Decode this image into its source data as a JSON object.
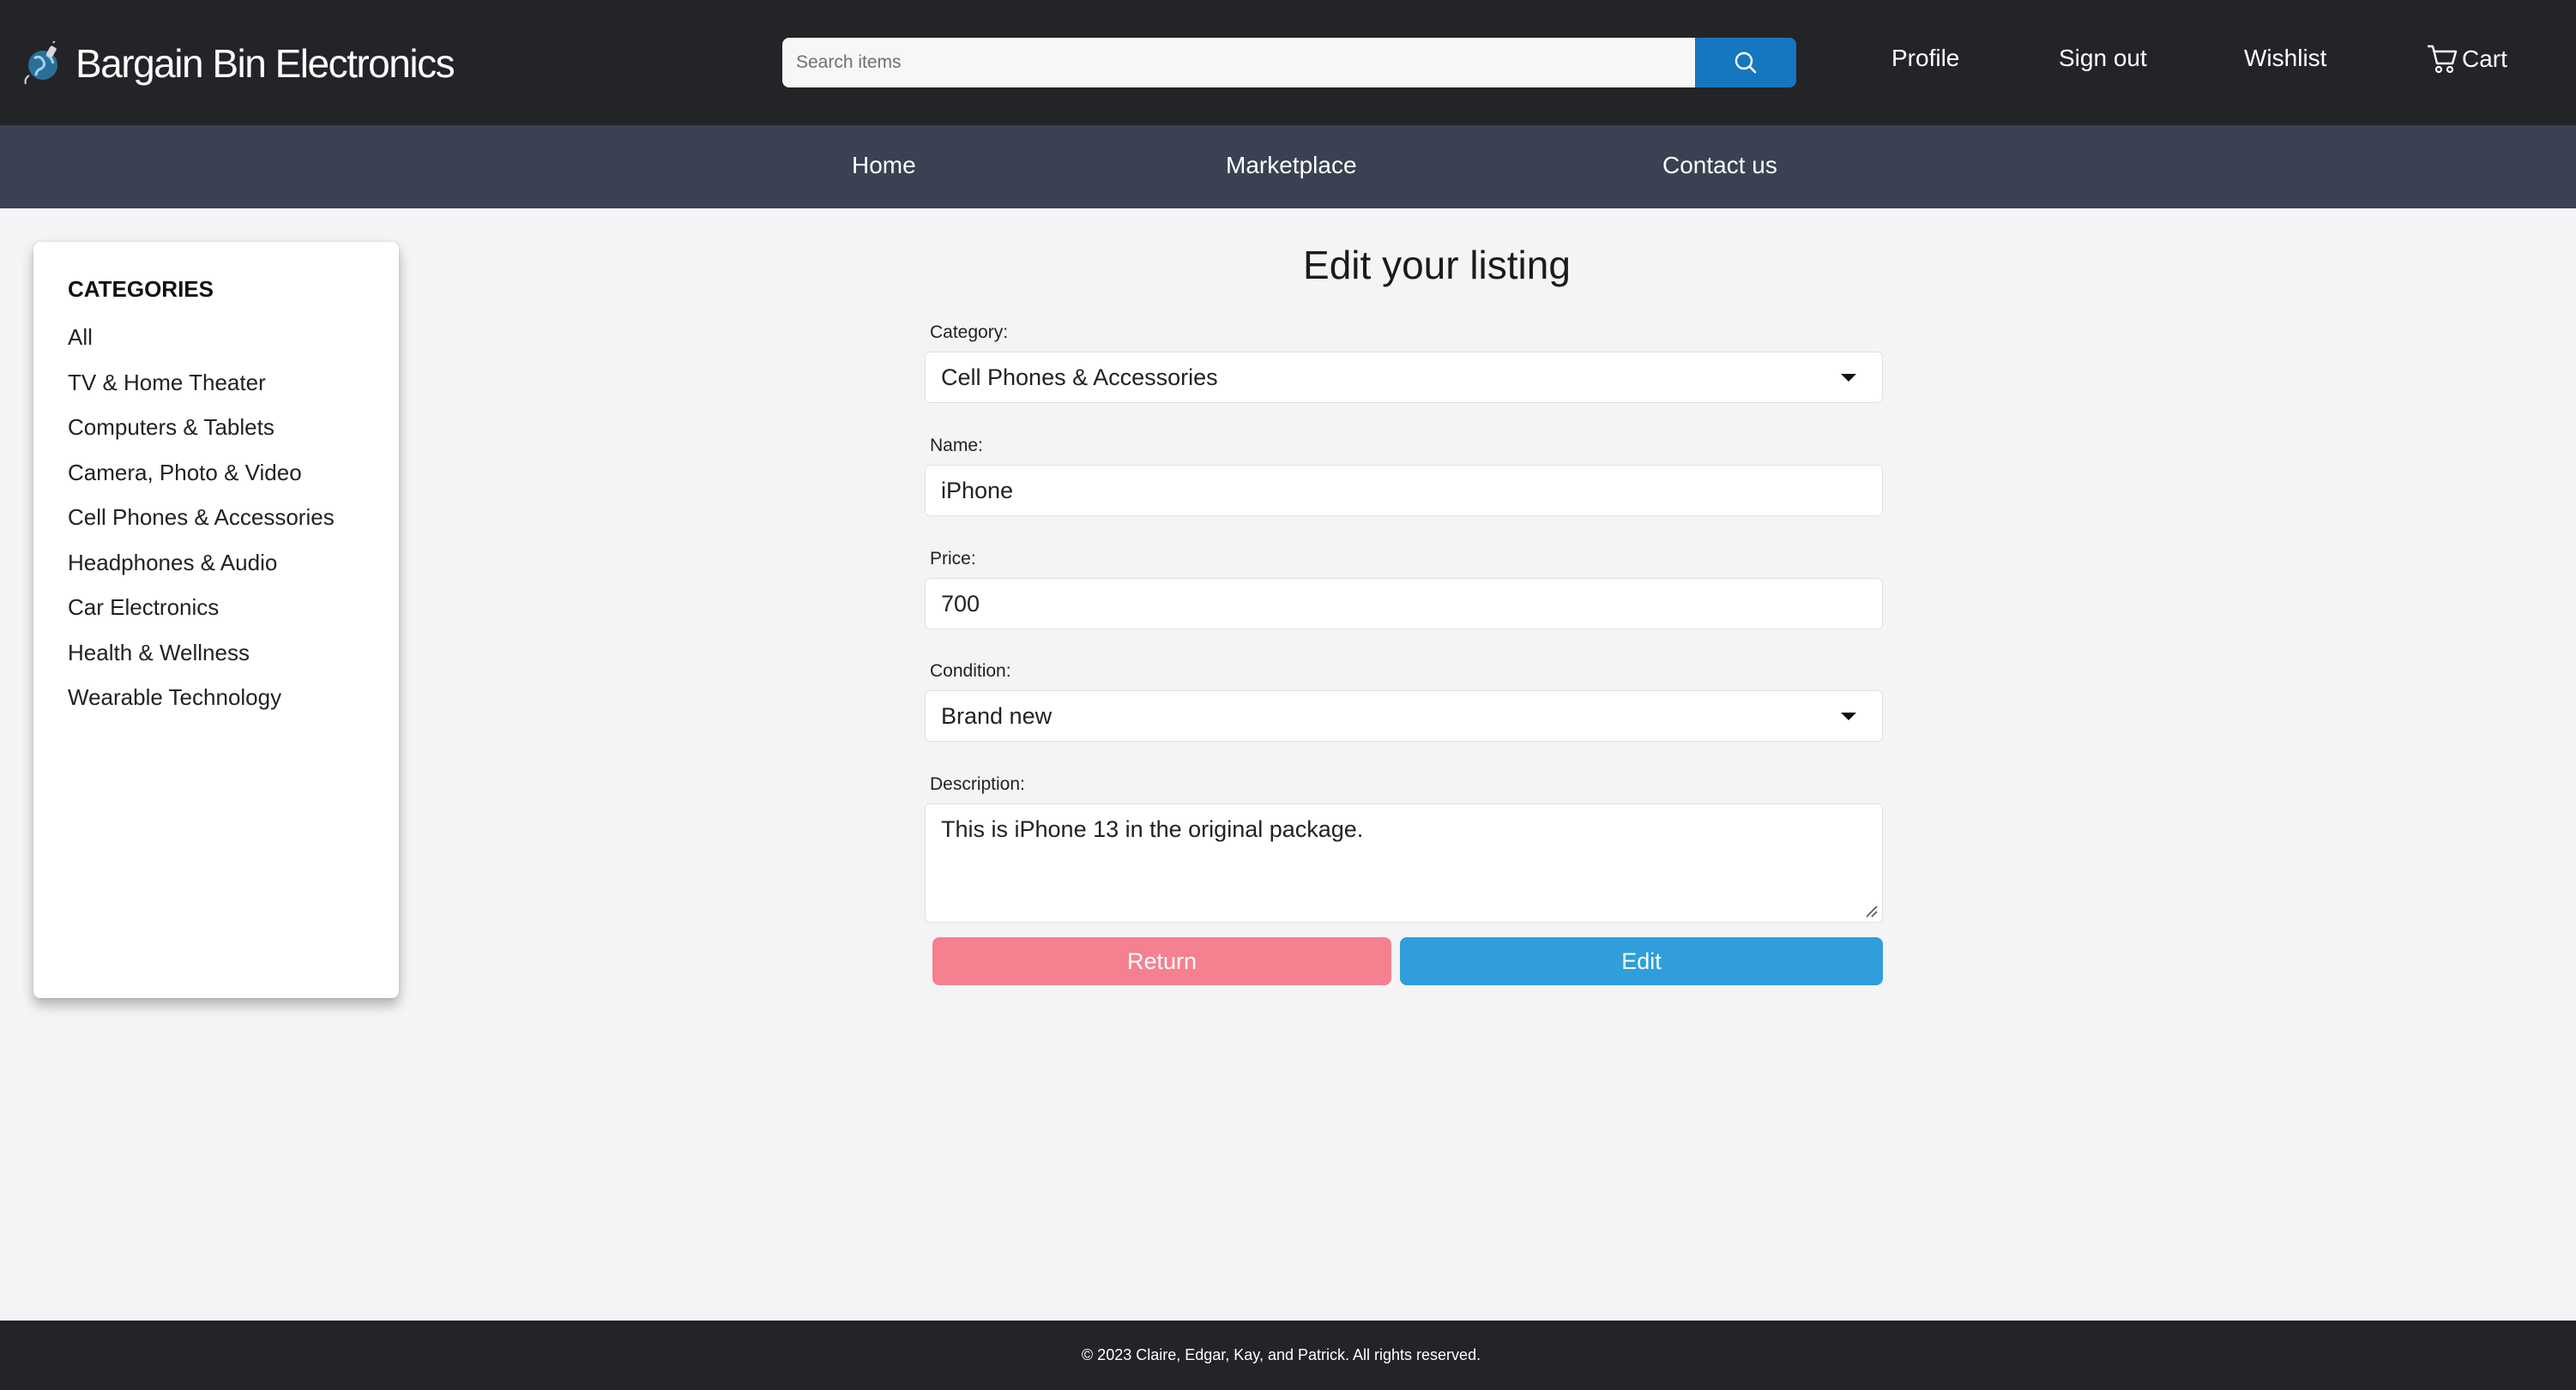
{
  "header": {
    "brand_name": "Bargain Bin Electronics",
    "brand_icon": "globe-plug-logo",
    "search_placeholder": "Search items",
    "search_icon": "magnifier-icon",
    "links": {
      "profile": "Profile",
      "sign_out": "Sign out",
      "wishlist": "Wishlist",
      "cart": "Cart"
    },
    "cart_icon": "shopping-cart-icon"
  },
  "nav": {
    "home": "Home",
    "marketplace": "Marketplace",
    "contact": "Contact us"
  },
  "sidebar": {
    "title": "CATEGORIES",
    "items": [
      "All",
      "TV & Home Theater",
      "Computers & Tablets",
      "Camera, Photo & Video",
      "Cell Phones & Accessories",
      "Headphones & Audio",
      "Car Electronics",
      "Health & Wellness",
      "Wearable Technology"
    ]
  },
  "form": {
    "title": "Edit your listing",
    "category_label": "Category:",
    "category_value": "Cell Phones & Accessories",
    "name_label": "Name:",
    "name_value": "iPhone",
    "price_label": "Price:",
    "price_value": "700",
    "condition_label": "Condition:",
    "condition_value": "Brand new",
    "description_label": "Description:",
    "description_value": "This is iPhone 13 in the original package.",
    "return_label": "Return",
    "edit_label": "Edit"
  },
  "footer": {
    "text": "© 2023 Claire, Edgar, Kay, and Patrick. All rights reserved."
  },
  "colors": {
    "header_bg": "#232427",
    "nav_bg": "#394152",
    "search_button": "#1477c0",
    "return_button": "#f5808f",
    "edit_button": "#2f9edb",
    "page_bg": "#f4f4f6"
  }
}
